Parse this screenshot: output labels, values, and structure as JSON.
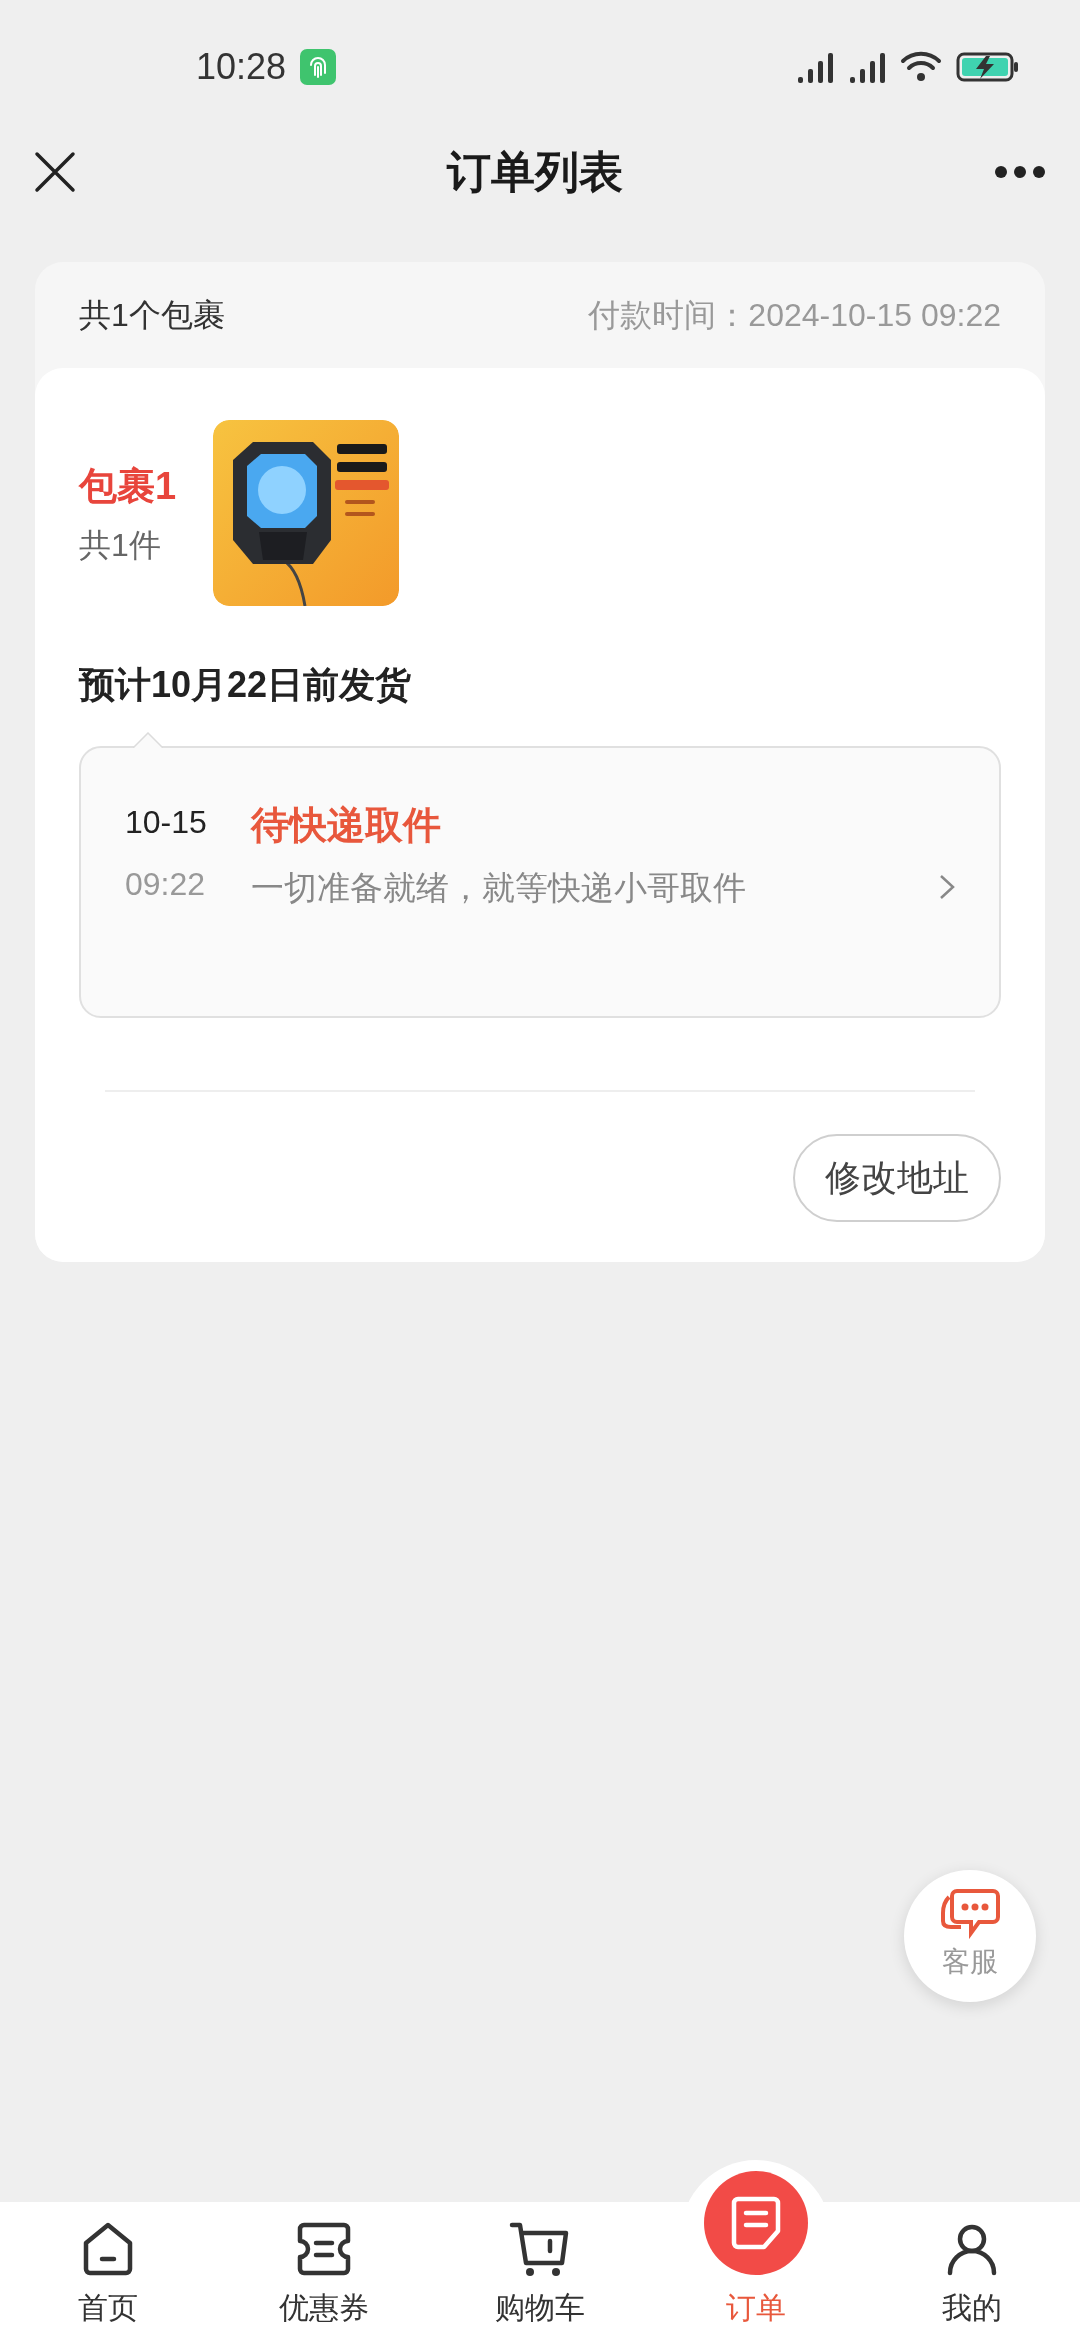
{
  "status_bar": {
    "time": "10:28"
  },
  "header": {
    "title": "订单列表"
  },
  "order": {
    "package_count": "共1个包裹",
    "paid_time": "付款时间：2024-10-15 09:22",
    "package": {
      "name": "包裹1",
      "item_count": "共1件",
      "ship_estimate": "预计10月22日前发货",
      "tracking": {
        "date": "10-15",
        "time": "09:22",
        "status": "待快递取件",
        "detail": "一切准备就绪，就等快递小哥取件"
      },
      "action": "修改地址"
    }
  },
  "service_button": {
    "label": "客服"
  },
  "tabs": [
    {
      "kind": "home",
      "label": "首页",
      "selected": false
    },
    {
      "kind": "coupon",
      "label": "优惠券",
      "selected": false
    },
    {
      "kind": "cart",
      "label": "购物车",
      "selected": false
    },
    {
      "kind": "order",
      "label": "订单",
      "selected": true
    },
    {
      "kind": "profile",
      "label": "我的",
      "selected": false
    }
  ]
}
